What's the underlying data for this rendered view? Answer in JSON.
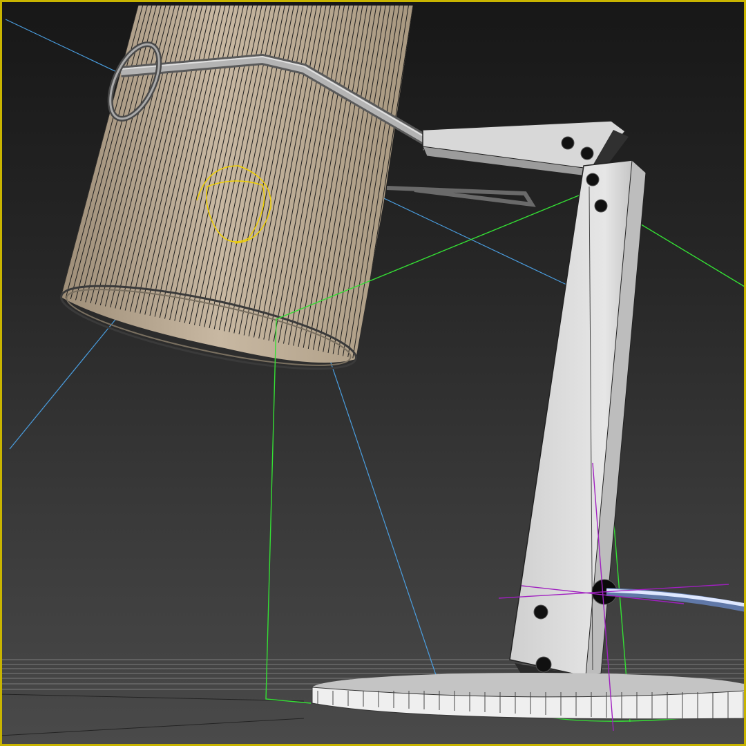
{
  "viewport": {
    "mode": "perspective-wireframe-on-shaded",
    "active_border_color": "#c8b400",
    "background_colors": [
      "#171717",
      "#4a4a4a"
    ]
  },
  "scene": {
    "objects": [
      {
        "name": "lamp-shade",
        "color": "#b8a892",
        "wire_color": "#1e1e1e"
      },
      {
        "name": "lamp-arm-rod",
        "color": "#8a8a8a"
      },
      {
        "name": "lamp-upper-bracket",
        "color": "#d6d6d6"
      },
      {
        "name": "lamp-body-column",
        "color": "#d9d9d9"
      },
      {
        "name": "lamp-base-disc",
        "color": "#e4e4e4"
      },
      {
        "name": "power-cable",
        "color": "#9bb0d6"
      }
    ],
    "light": {
      "target_color": "#4a9ee0",
      "spot_shape_color": "#f0d000",
      "selection_box_color": "#34e034",
      "transform_gizmo_color": "#a020c0"
    },
    "grid_color": "#8a8a8a"
  }
}
